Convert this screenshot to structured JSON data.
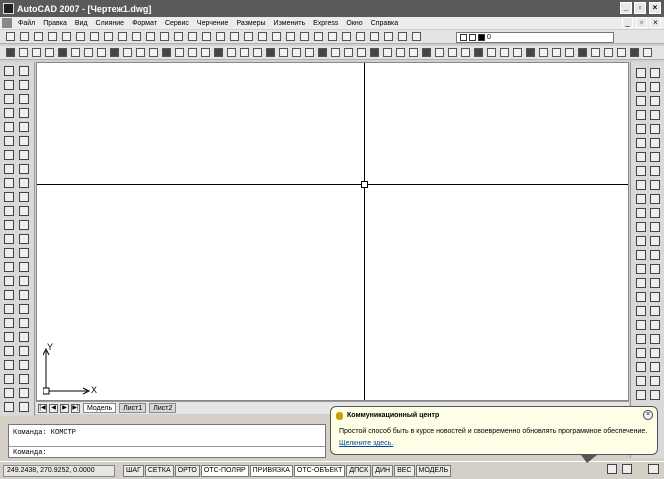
{
  "window": {
    "title": "AutoCAD 2007 - [Чертеж1.dwg]",
    "minimize_label": "_",
    "restore_label": "▫",
    "close_label": "×"
  },
  "menu": {
    "items": [
      "Файл",
      "Правка",
      "Вид",
      "Слияние",
      "Формат",
      "Сервис",
      "Черчение",
      "Размеры",
      "Изменить",
      "Express",
      "Окно",
      "Справка"
    ],
    "doc_minimize": "_",
    "doc_restore": "▫",
    "doc_close": "×"
  },
  "layer_control": {
    "value": "0"
  },
  "layout_tabs": {
    "nav": [
      "|◀",
      "◀",
      "▶",
      "▶|"
    ],
    "tabs": [
      "Модель",
      "Лист1",
      "Лист2"
    ],
    "active": "Модель"
  },
  "ucs": {
    "x_label": "X",
    "y_label": "Y"
  },
  "command_line": {
    "line1": "Команда:  КОМСТР",
    "line2": "Команда:"
  },
  "status_bar": {
    "coordinates": "249.2438, 270.9252, 0.0000",
    "buttons": [
      "ШАГ",
      "СЕТКА",
      "ОРТО",
      "ОТС-ПОЛЯР",
      "ПРИВЯЗКА",
      "ОТС-ОБЪЕКТ",
      "ДПСК",
      "ДИН",
      "ВЕС",
      "МОДЕЛЬ"
    ]
  },
  "notification": {
    "title": "Коммуникационный центр",
    "body": "Простой способ быть в курсе новостей и своевременно обновлять программное обеспечение.",
    "link": "Щелкните здесь.",
    "close_label": "×"
  }
}
